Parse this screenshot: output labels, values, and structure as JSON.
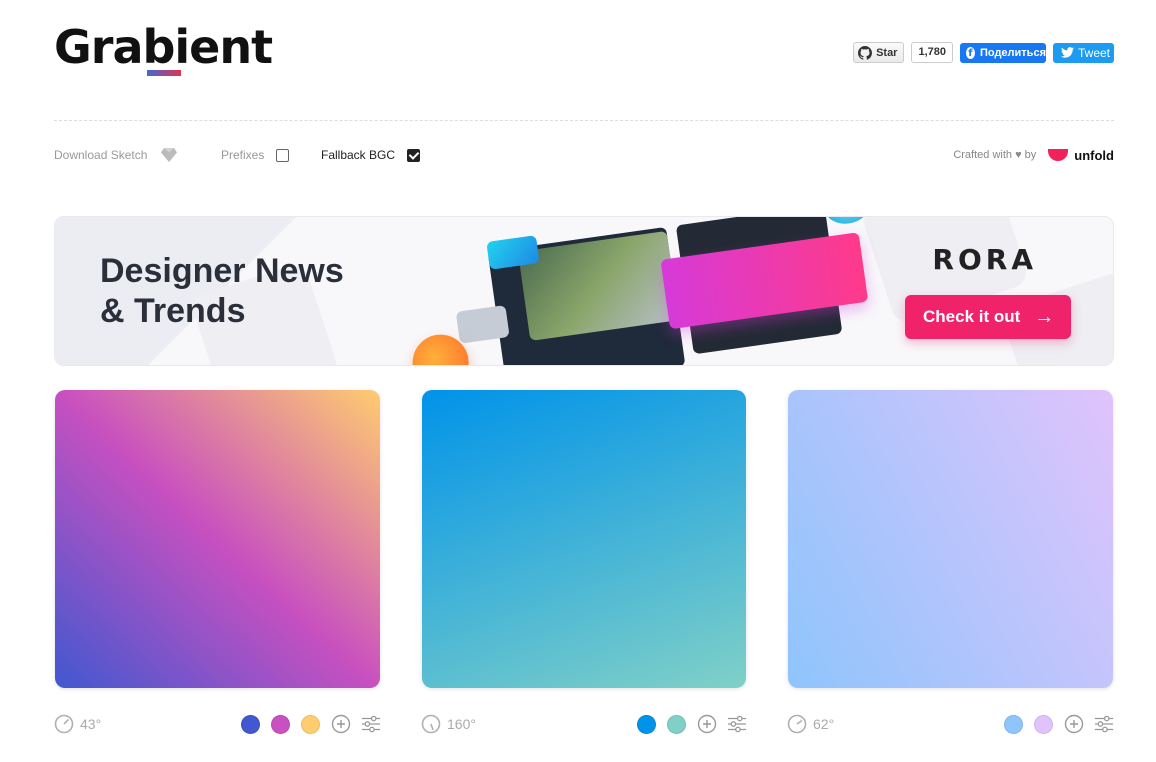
{
  "header": {
    "logo": "Grabient",
    "github": {
      "label": "Star",
      "count": "1,780"
    },
    "facebook": {
      "label": "Поделиться"
    },
    "twitter": {
      "label": "Tweet"
    }
  },
  "options": {
    "download_sketch": "Download Sketch",
    "prefixes": {
      "label": "Prefixes",
      "checked": false
    },
    "fallback_bgc": {
      "label": "Fallback BGC",
      "checked": true
    },
    "crafted_by": "Crafted with ♥ by",
    "brand": "unfold"
  },
  "banner": {
    "title_line1": "Designer News",
    "title_line2": "& Trends",
    "brand": "RORA",
    "cta": "Check it out"
  },
  "gradients": [
    {
      "angle": "43°",
      "stops": [
        "#4158D0",
        "#C850C0",
        "#FFCC70"
      ]
    },
    {
      "angle": "160°",
      "stops": [
        "#0093E9",
        "#80D0C7"
      ]
    },
    {
      "angle": "62°",
      "stops": [
        "#8EC5FC",
        "#E0C3FC"
      ]
    }
  ],
  "colors": {
    "accent_pink": "#f0236a",
    "unfold_red": "#f0215b"
  }
}
